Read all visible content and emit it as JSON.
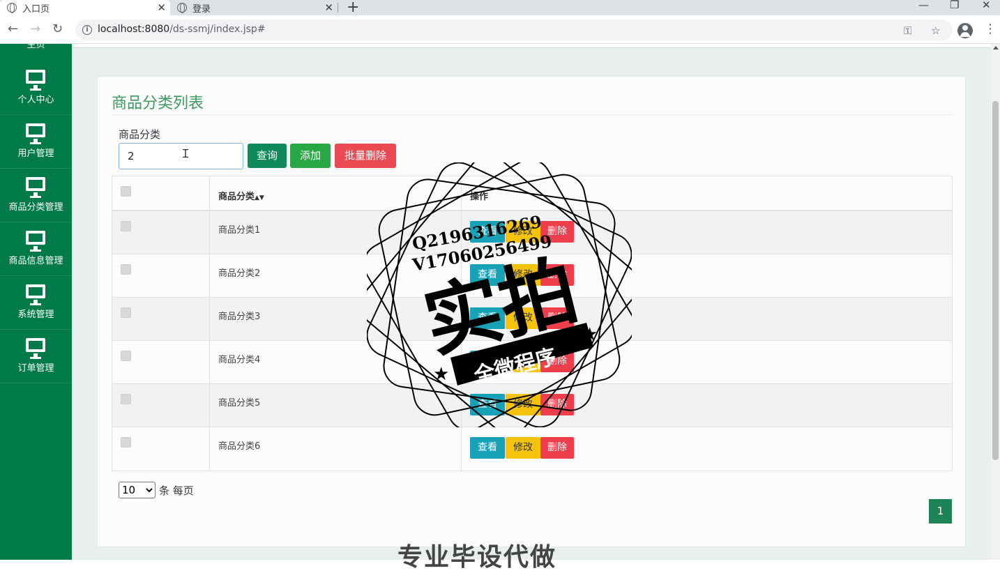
{
  "browser": {
    "tabs": [
      {
        "title": "入口页",
        "active": true
      },
      {
        "title": "登录",
        "active": false
      }
    ],
    "url_host": "localhost:8080",
    "url_path": "/ds-ssmj/index.jsp#"
  },
  "sidebar": {
    "top_partial_label": "主页",
    "items": [
      {
        "label": "个人中心",
        "icon": "monitor-icon"
      },
      {
        "label": "用户管理",
        "icon": "monitor-icon"
      },
      {
        "label": "商品分类管理",
        "icon": "monitor-icon"
      },
      {
        "label": "商品信息管理",
        "icon": "monitor-icon"
      },
      {
        "label": "系统管理",
        "icon": "monitor-icon"
      },
      {
        "label": "订单管理",
        "icon": "monitor-icon"
      }
    ]
  },
  "page": {
    "title": "商品分类列表",
    "filter_label": "商品分类",
    "filter_value": "2",
    "buttons": {
      "query": "查询",
      "add": "添加",
      "batch_delete": "批量删除"
    },
    "table": {
      "headers": [
        "商品分类",
        "操作"
      ],
      "rows": [
        "商品分类1",
        "商品分类2",
        "商品分类3",
        "商品分类4",
        "商品分类5",
        "商品分类6"
      ],
      "ops": {
        "view": "查看",
        "edit": "修改",
        "delete": "删除"
      }
    },
    "page_size": "10",
    "page_size_suffix": "条 每页",
    "current_page": "1"
  },
  "watermark": {
    "line1": "Q2196316269",
    "line2": "V17060256499",
    "big": "实拍",
    "banner": "全微程序",
    "bottom": "专业毕设代做"
  },
  "colors": {
    "sidebar": "#007a48",
    "title": "#3d9a5f",
    "accent": "#1e8457"
  }
}
